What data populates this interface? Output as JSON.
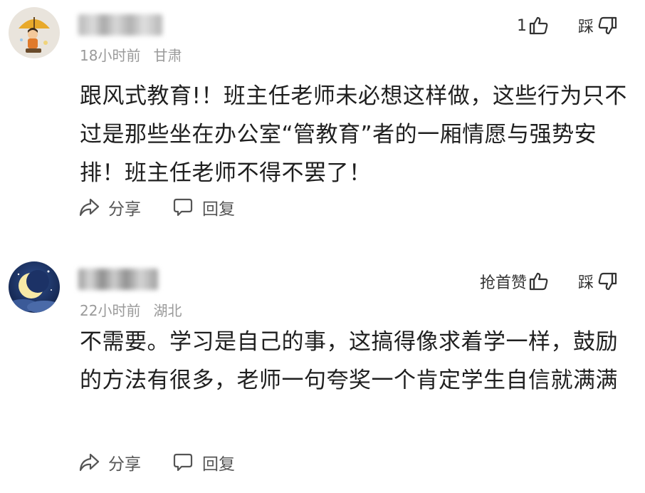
{
  "comments": [
    {
      "time": "18小时前",
      "region": "甘肃",
      "like_label": "1",
      "dislike_label": "踩",
      "text": "跟风式教育!！班主任老师未必想这样做，这些行为只不过是那些坐在办公室“管教育”者的一厢情愿与强势安排！班主任老师不得不罢了！",
      "share_label": "分享",
      "reply_label": "回复"
    },
    {
      "time": "22小时前",
      "region": "湖北",
      "like_label": "抢首赞",
      "dislike_label": "踩",
      "text": "不需要。学习是自己的事，这搞得像求着学一样，鼓励的方法有很多，老师一句夸奖一个肯定学生自信就满满",
      "share_label": "分享",
      "reply_label": "回复"
    }
  ]
}
